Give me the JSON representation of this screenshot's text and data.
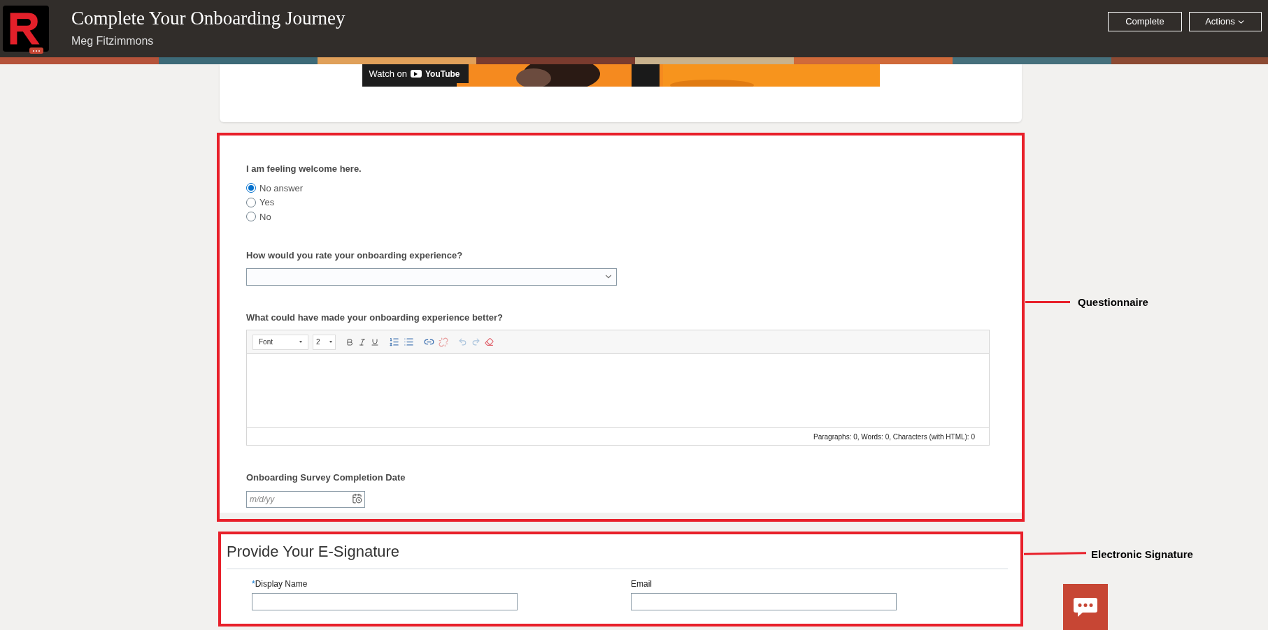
{
  "header": {
    "title": "Complete Your Onboarding Journey",
    "subtitle": "Meg Fitzimmons",
    "buttons": [
      {
        "label": "Complete",
        "kind": "plain"
      },
      {
        "label": "Actions",
        "kind": "menu"
      }
    ]
  },
  "video": {
    "watch_label": "Watch on",
    "logo_text": "YouTube"
  },
  "questionnaire": {
    "questions": [
      {
        "kind": "radio",
        "label": "I am feeling welcome here.",
        "options": [
          {
            "label": "No answer",
            "selected": true
          },
          {
            "label": "Yes",
            "selected": false
          },
          {
            "label": "No",
            "selected": false
          }
        ]
      },
      {
        "kind": "select",
        "label": "How would you rate your onboarding experience?"
      },
      {
        "kind": "rich_text",
        "label": "What could have made your onboarding experience better?",
        "font": "Font",
        "size": "2",
        "status": "Paragraphs: 0, Words: 0, Characters (with HTML): 0"
      },
      {
        "kind": "date",
        "label": "Onboarding Survey Completion Date",
        "placeholder": "m/d/yy"
      }
    ]
  },
  "signature": {
    "title": "Provide Your E-Signature",
    "fields": [
      {
        "label": "Display Name",
        "required_mark": "*"
      },
      {
        "label": "Email"
      }
    ]
  },
  "annotations": [
    {
      "label": "Questionnaire"
    },
    {
      "label": "Electronic Signature"
    }
  ]
}
